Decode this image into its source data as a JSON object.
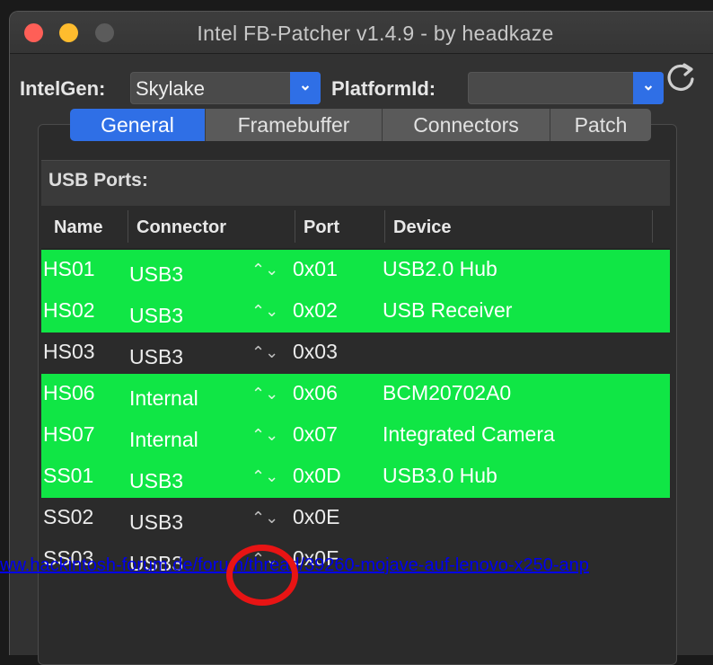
{
  "window": {
    "title": "Intel FB-Patcher v1.4.9 - by headkaze"
  },
  "toolbar": {
    "intelgen_label": "IntelGen:",
    "intelgen_value": "Skylake",
    "platformid_label": "PlatformId:",
    "platformid_value": "",
    "chevron": "⌄"
  },
  "tabs": [
    {
      "label": "General",
      "active": true
    },
    {
      "label": "Framebuffer",
      "active": false
    },
    {
      "label": "Connectors",
      "active": false
    },
    {
      "label": "Patch",
      "active": false
    }
  ],
  "usb": {
    "section_title": "USB Ports:",
    "columns": {
      "name": "Name",
      "connector": "Connector",
      "port": "Port",
      "device": "Device"
    },
    "stepper_glyph": "⌃⌄",
    "rows": [
      {
        "name": "HS01",
        "connector": "USB3",
        "port": "0x01",
        "device": "USB2.0 Hub",
        "enabled": true
      },
      {
        "name": "HS02",
        "connector": "USB3",
        "port": "0x02",
        "device": "USB Receiver",
        "enabled": true
      },
      {
        "name": "HS03",
        "connector": "USB3",
        "port": "0x03",
        "device": "",
        "enabled": false
      },
      {
        "name": "HS06",
        "connector": "Internal",
        "port": "0x06",
        "device": "BCM20702A0",
        "enabled": true
      },
      {
        "name": "HS07",
        "connector": "Internal",
        "port": "0x07",
        "device": "Integrated Camera",
        "enabled": true
      },
      {
        "name": "SS01",
        "connector": "USB3",
        "port": "0x0D",
        "device": "USB3.0 Hub",
        "enabled": true
      },
      {
        "name": "SS02",
        "connector": "USB3",
        "port": "0x0E",
        "device": "",
        "enabled": false
      },
      {
        "name": "SS03",
        "connector": "USB3",
        "port": "0x0F",
        "device": "",
        "enabled": false
      }
    ]
  },
  "overlay": {
    "url_text": "ww.hackintosh-forum.de/forum/thread/39260-mojave-auf-lenovo-x250-anp"
  },
  "colors": {
    "enabled_row": "#10e645",
    "accent": "#2f6fe6",
    "highlight_circle": "#e81414"
  }
}
